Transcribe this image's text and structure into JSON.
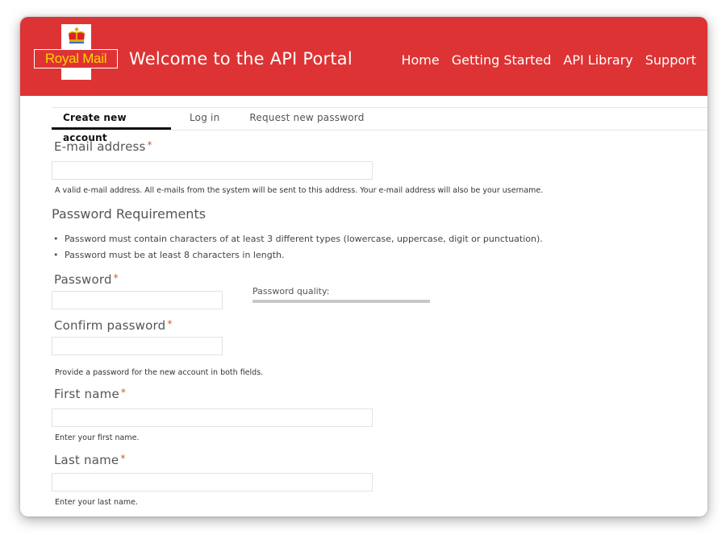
{
  "header": {
    "logo_text": "Royal Mail",
    "title": "Welcome to the API Portal",
    "nav": [
      "Home",
      "Getting Started",
      "API Library",
      "Support"
    ],
    "brand_color": "#de3334",
    "logo_text_color": "#ffd200"
  },
  "tabs": [
    {
      "label": "Create new account",
      "active": true
    },
    {
      "label": "Log in",
      "active": false
    },
    {
      "label": "Request new password",
      "active": false
    }
  ],
  "form": {
    "required_marker": "*",
    "email": {
      "label": "E-mail address",
      "value": "",
      "description": "A valid e-mail address. All e-mails from the system will be sent to this address. Your e-mail address will also be your username."
    },
    "password_requirements": {
      "title": "Password Requirements",
      "bullet": "•",
      "items": [
        "Password must contain characters of at least 3 different types (lowercase, uppercase, digit or punctuation).",
        "Password must be at least 8 characters in length."
      ]
    },
    "password": {
      "label": "Password",
      "value": ""
    },
    "password_quality": {
      "label": "Password quality:",
      "level_percent": 0
    },
    "confirm_password": {
      "label": "Confirm password",
      "value": "",
      "description": "Provide a password for the new account in both fields."
    },
    "first_name": {
      "label": "First name",
      "value": "",
      "description": "Enter your first name."
    },
    "last_name": {
      "label": "Last name",
      "value": "",
      "description": "Enter your last name."
    }
  }
}
